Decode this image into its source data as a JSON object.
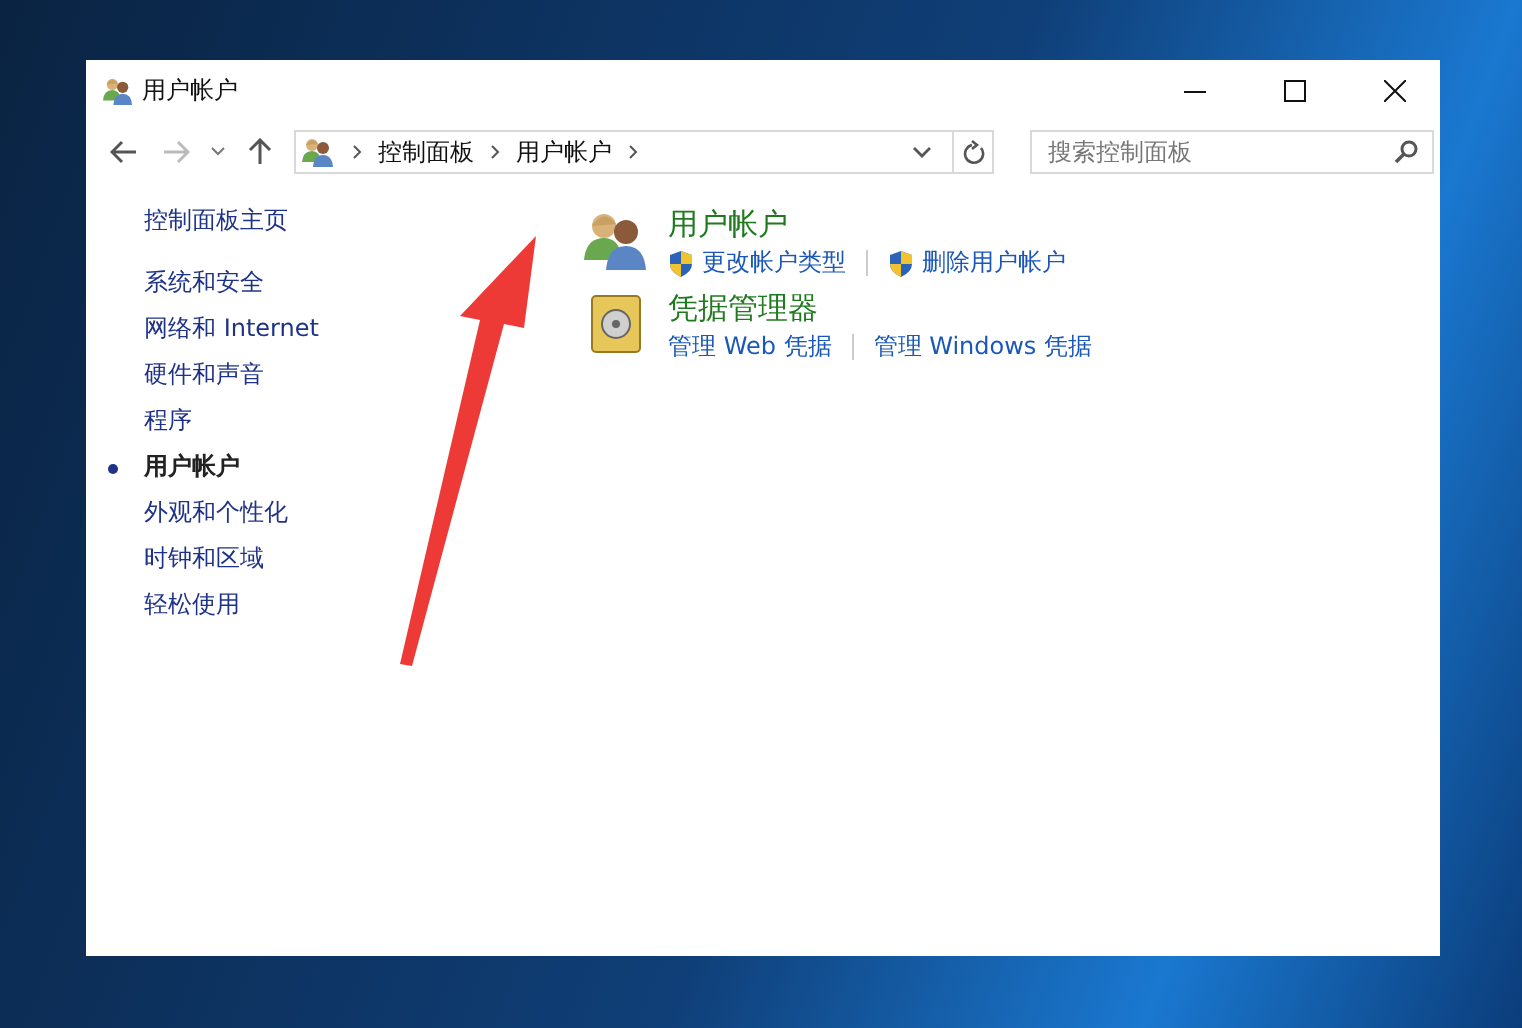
{
  "window": {
    "title": "用户帐户"
  },
  "address_bar": {
    "crumbs": [
      "控制面板",
      "用户帐户"
    ]
  },
  "search": {
    "placeholder": "搜索控制面板"
  },
  "sidebar": {
    "home": "控制面板主页",
    "items": [
      {
        "label": "系统和安全",
        "selected": false
      },
      {
        "label": "网络和 Internet",
        "selected": false
      },
      {
        "label": "硬件和声音",
        "selected": false
      },
      {
        "label": "程序",
        "selected": false
      },
      {
        "label": "用户帐户",
        "selected": true
      },
      {
        "label": "外观和个性化",
        "selected": false
      },
      {
        "label": "时钟和区域",
        "selected": false
      },
      {
        "label": "轻松使用",
        "selected": false
      }
    ]
  },
  "sections": [
    {
      "kind": "users",
      "title": "用户帐户",
      "links": [
        {
          "label": "更改帐户类型",
          "shield": true
        },
        {
          "label": "删除用户帐户",
          "shield": true
        }
      ]
    },
    {
      "kind": "vault",
      "title": "凭据管理器",
      "links": [
        {
          "label": "管理 Web 凭据",
          "shield": false
        },
        {
          "label": "管理 Windows 凭据",
          "shield": false
        }
      ]
    }
  ]
}
